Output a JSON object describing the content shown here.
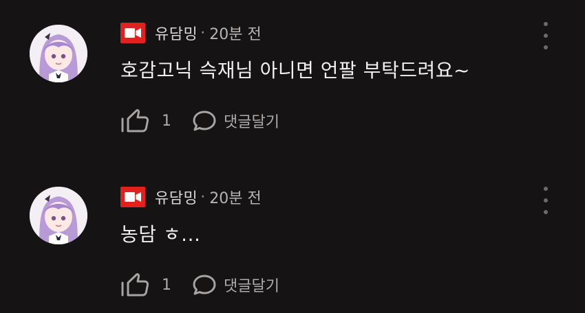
{
  "colors": {
    "background": "#151313",
    "badge_red": "#e0211d",
    "text_primary": "#f2f0f0",
    "text_secondary": "#b0acac"
  },
  "comments": [
    {
      "author": "유담밍",
      "separator": "·",
      "time": "20분 전",
      "text": "호감고닉 슥재님 아니면 언팔 부탁드려요~",
      "like_count": "1",
      "reply_label": "댓글달기",
      "icons": [
        "avatar-image",
        "video-badge-icon",
        "more-options-icon",
        "thumbs-up-icon",
        "chat-bubble-icon"
      ]
    },
    {
      "author": "유담밍",
      "separator": "·",
      "time": "20분 전",
      "text": "농담 ㅎ...",
      "like_count": "1",
      "reply_label": "댓글달기",
      "icons": [
        "avatar-image",
        "video-badge-icon",
        "more-options-icon",
        "thumbs-up-icon",
        "chat-bubble-icon"
      ]
    }
  ]
}
